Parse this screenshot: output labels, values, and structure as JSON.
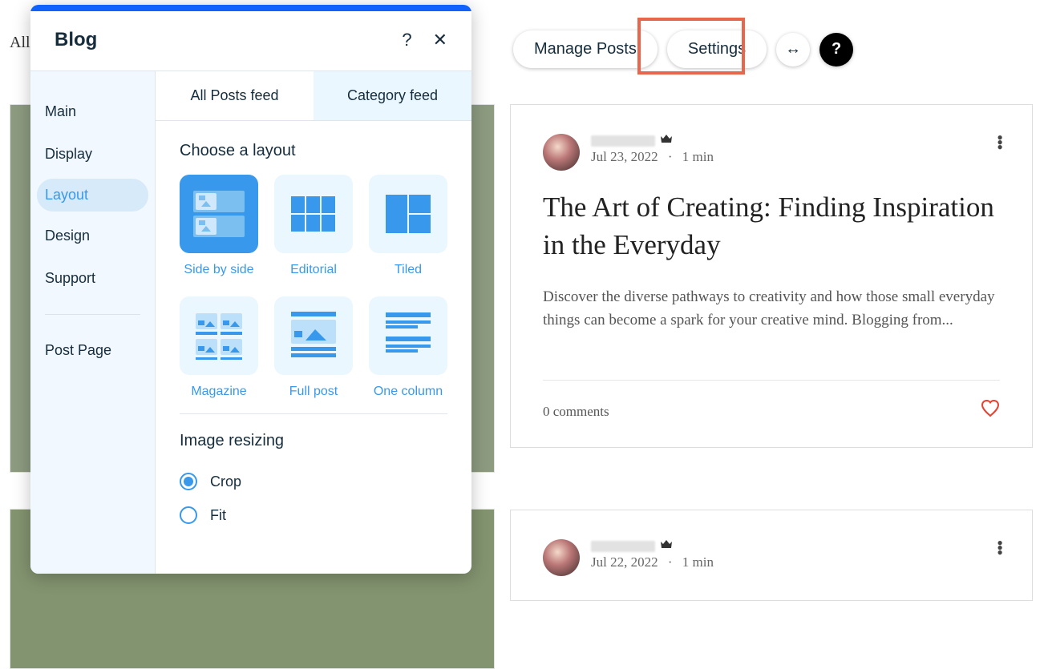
{
  "bg": {
    "text_left": "All"
  },
  "toolbar": {
    "manage_posts": "Manage Posts",
    "settings": "Settings"
  },
  "panel": {
    "title": "Blog",
    "sidebar": {
      "items": [
        "Main",
        "Display",
        "Layout",
        "Design",
        "Support",
        "Post Page"
      ],
      "active_index": 2
    },
    "tabs": {
      "all_posts": "All Posts feed",
      "category": "Category feed",
      "active": "all_posts"
    },
    "layout_section": {
      "title": "Choose a layout",
      "options": [
        "Side by side",
        "Editorial",
        "Tiled",
        "Magazine",
        "Full post",
        "One column"
      ],
      "selected_index": 0
    },
    "image_resizing": {
      "title": "Image resizing",
      "options": [
        "Crop",
        "Fit"
      ],
      "selected_index": 0
    }
  },
  "posts": [
    {
      "date": "Jul 23, 2022",
      "read_time": "1 min",
      "title": "The Art of Creating: Finding Inspiration in the Everyday",
      "excerpt": "Discover the diverse pathways to creativity and how those small everyday things can become a spark for your creative mind. Blogging from...",
      "comments": "0 comments"
    },
    {
      "date": "Jul 22, 2022",
      "read_time": "1 min"
    }
  ]
}
